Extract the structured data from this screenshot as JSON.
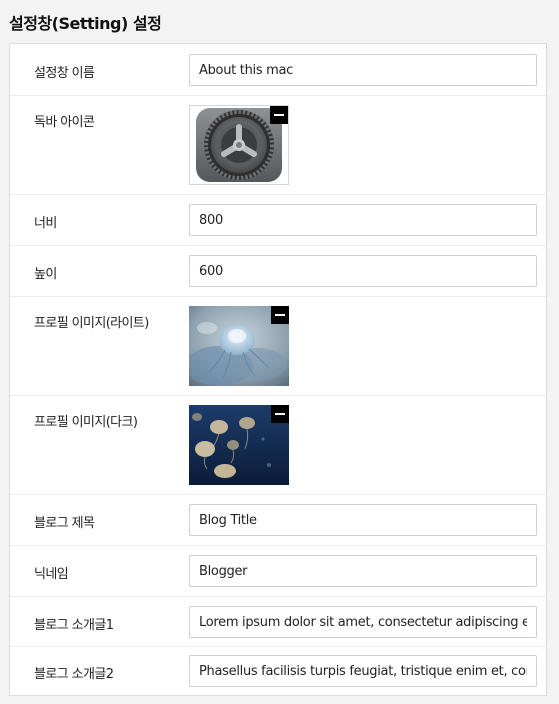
{
  "page": {
    "title": "설정창(Setting) 설정"
  },
  "settings": {
    "window_name": {
      "label": "설정창 이름",
      "value": "About this mac"
    },
    "dock_icon": {
      "label": "독바 아이콘",
      "image": "gear-icon"
    },
    "width": {
      "label": "너비",
      "value": "800"
    },
    "height": {
      "label": "높이",
      "value": "600"
    },
    "profile_light": {
      "label": "프로필 이미지(라이트)",
      "image": "jellyfish-photo"
    },
    "profile_dark": {
      "label": "프로필 이미지(다크)",
      "image": "jellyfish-dark-photo"
    },
    "blog_title": {
      "label": "블로그 제목",
      "value": "Blog Title"
    },
    "nickname": {
      "label": "닉네임",
      "value": "Blogger"
    },
    "blog_intro1": {
      "label": "블로그 소개글1",
      "value": "Lorem ipsum dolor sit amet, consectetur adipiscing elit."
    },
    "blog_intro2": {
      "label": "블로그 소개글2",
      "value": "Phasellus facilisis turpis feugiat, tristique enim et, commodo"
    }
  }
}
